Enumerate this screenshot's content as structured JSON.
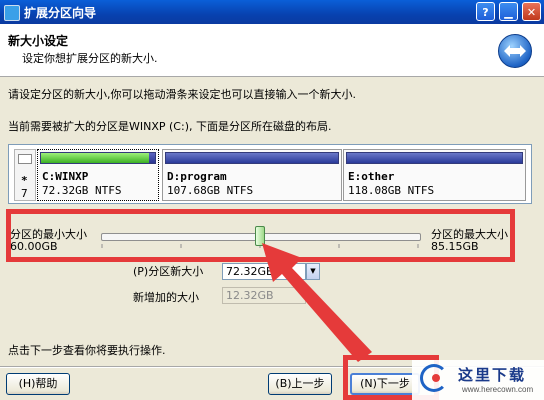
{
  "window": {
    "title": "扩展分区向导"
  },
  "header": {
    "title": "新大小设定",
    "subtitle": "设定你想扩展分区的新大小."
  },
  "instructions": {
    "line1": "请设定分区的新大小,你可以拖动滑条来设定也可以直接输入一个新大小.",
    "line2": "当前需要被扩大的分区是WINXP (C:), 下面是分区所在磁盘的布局."
  },
  "disk": {
    "side_marker": "*",
    "side_number": "7",
    "partitions": [
      {
        "name": "C:WINXP",
        "size": "72.32GB NTFS",
        "used_fraction": 0.95
      },
      {
        "name": "D:program",
        "size": "107.68GB NTFS",
        "used_fraction": 0
      },
      {
        "name": "E:other",
        "size": "118.08GB NTFS",
        "used_fraction": 0
      }
    ]
  },
  "slider": {
    "min_label": "分区的最小大小",
    "min_value": "60.00GB",
    "max_label": "分区的最大大小",
    "max_value": "85.15GB",
    "position_fraction": 0.49
  },
  "fields": {
    "new_size_label": "(P)分区新大小",
    "new_size_value": "72.32GB",
    "added_label": "新增加的大小",
    "added_value": "12.32GB"
  },
  "footer_hint": "点击下一步查看你将要执行操作.",
  "buttons": {
    "help": "(H)帮助",
    "back": "(B)上一步",
    "next": "(N)下一步"
  },
  "watermark": {
    "text": "这里下载",
    "url": "www.herecown.com"
  },
  "colors": {
    "annotation_red": "#e53a3a",
    "title_blue": "#0842b0"
  }
}
